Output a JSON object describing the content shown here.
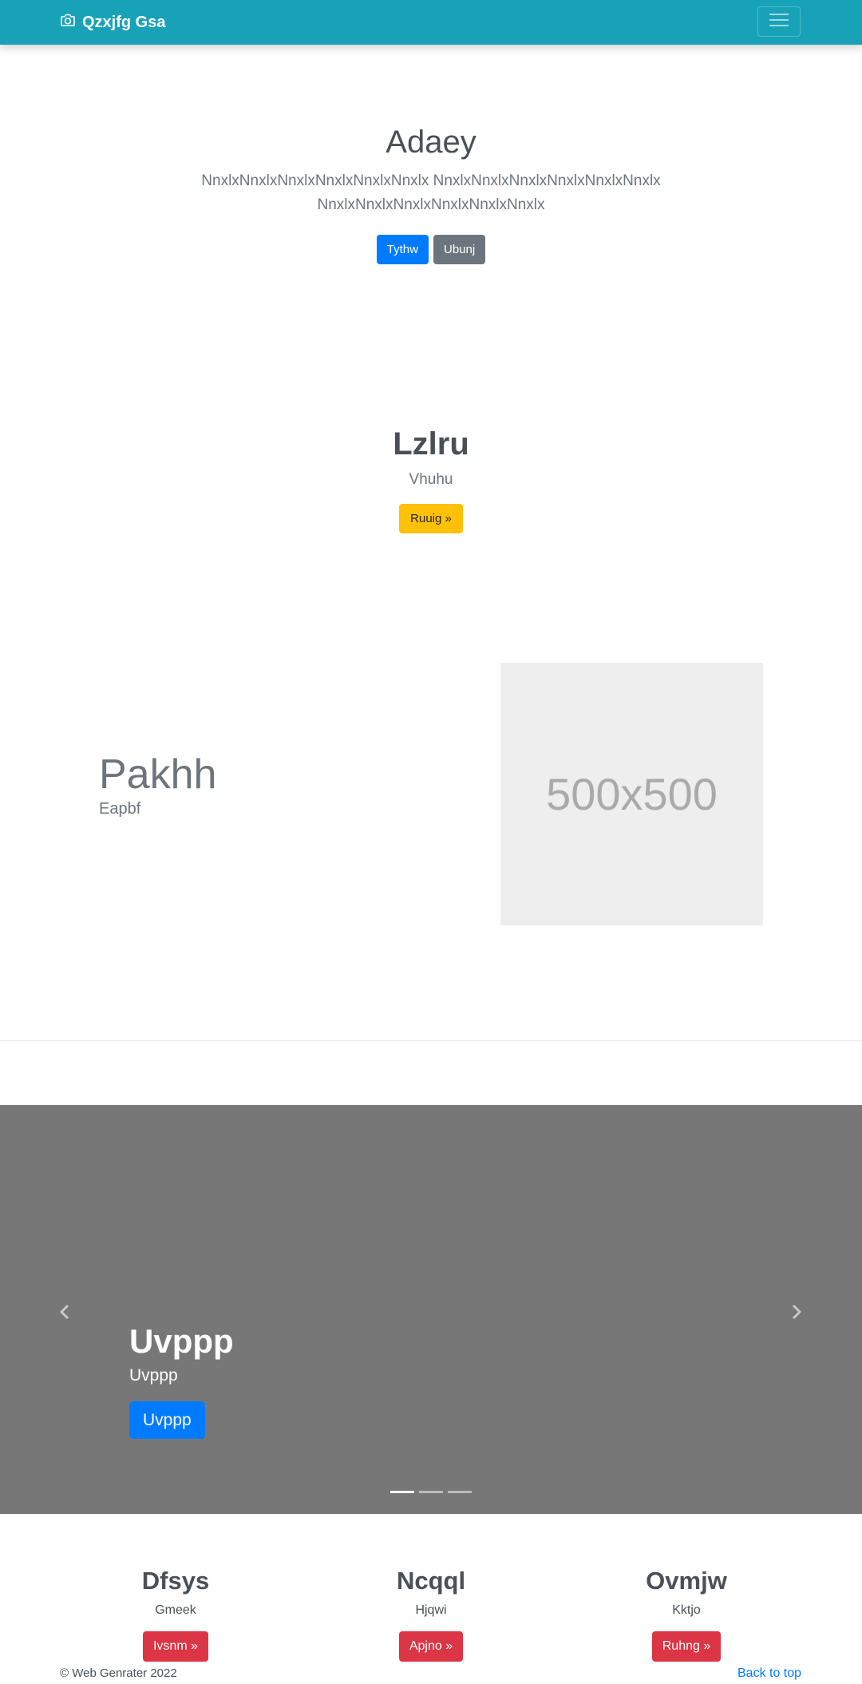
{
  "navbar": {
    "brand": "Qzxjfg Gsa",
    "brand_icon": "camera-icon",
    "toggler_icon": "hamburger-icon"
  },
  "hero": {
    "title": "Adaey",
    "lead": "NnxlxNnxlxNnxlxNnxlxNnxlxNnxlx NnxlxNnxlxNnxlxNnxlxNnxlxNnxlx NnxlxNnxlxNnxlxNnxlxNnxlxNnxlx",
    "primary_button": "Tythw",
    "secondary_button": "Ubunj"
  },
  "feature": {
    "title": "Lzlru",
    "subtitle": "Vhuhu",
    "button": "Ruuig »"
  },
  "split": {
    "title": "Pakhh",
    "subtitle": "Eapbf",
    "placeholder_text": "500x500"
  },
  "carousel": {
    "caption_title": "Uvppp",
    "caption_text": "Uvppp",
    "caption_button": "Uvppp",
    "prev_icon": "chevron-left-icon",
    "next_icon": "chevron-right-icon",
    "slide_count": 3,
    "active_slide": 1
  },
  "columns": [
    {
      "title": "Dfsys",
      "text": "Gmeek",
      "button": "Ivsnm »"
    },
    {
      "title": "Ncqql",
      "text": "Hjqwi",
      "button": "Apjno »"
    },
    {
      "title": "Ovmjw",
      "text": "Kktjo",
      "button": "Ruhng »"
    }
  ],
  "footer": {
    "copyright": "© Web Genrater 2022",
    "back_to_top": "Back to top"
  },
  "colors": {
    "navbar": "#17a2b8",
    "primary": "#007bff",
    "secondary": "#6c757d",
    "warning": "#ffc107",
    "danger": "#dc3545",
    "carousel_bg": "#777777"
  }
}
